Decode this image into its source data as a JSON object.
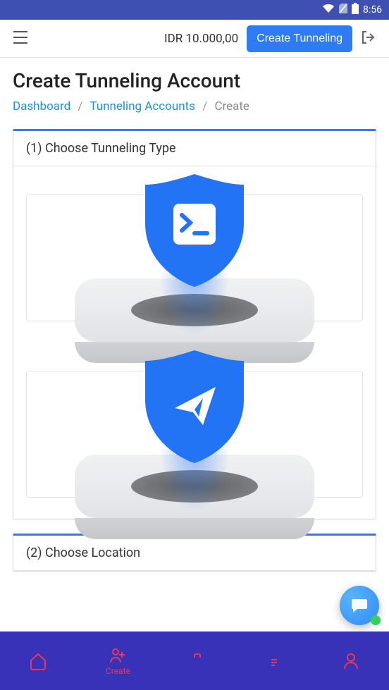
{
  "status": {
    "time": "8:56"
  },
  "topnav": {
    "balance": "IDR 10.000,00",
    "create_btn": "Create Tunneling"
  },
  "page": {
    "title": "Create Tunneling Account"
  },
  "breadcrumb": {
    "dashboard": "Dashboard",
    "tunneling": "Tunneling Accounts",
    "current": "Create"
  },
  "steps": {
    "step1": {
      "title": "(1) Choose Tunneling Type"
    },
    "step2": {
      "title": "(2) Choose Location"
    }
  },
  "bottomnav": {
    "create_label": "Create"
  }
}
